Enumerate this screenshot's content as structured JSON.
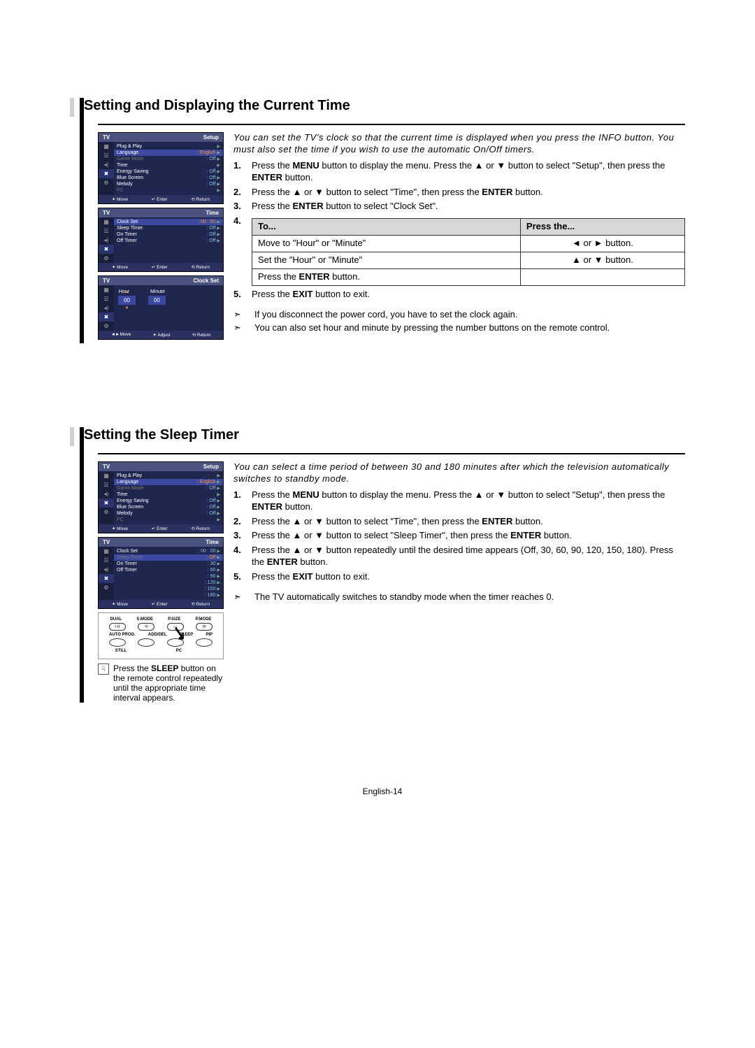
{
  "section1": {
    "title": "Setting and Displaying the Current Time",
    "intro": "You can set the TV's clock so that the current time is displayed when you press the INFO button. You must also set the time if you wish to use the automatic On/Off timers.",
    "steps": [
      {
        "n": "1.",
        "pre": "Press the ",
        "b1": "MENU",
        "mid": " button to display the menu. Press the ▲ or ▼ button to select \"Setup\", then press the ",
        "b2": "ENTER",
        "post": " button."
      },
      {
        "n": "2.",
        "pre": "Press the ▲ or ▼ button to select \"Time\", then press the ",
        "b1": "ENTER",
        "mid": "",
        "b2": "",
        "post": " button."
      },
      {
        "n": "3.",
        "pre": "Press the ",
        "b1": "ENTER",
        "mid": " button to select \"Clock Set\".",
        "b2": "",
        "post": ""
      }
    ],
    "step4n": "4.",
    "table": {
      "h1": "To...",
      "h2": "Press the...",
      "r1c1": "Move to \"Hour\" or \"Minute\"",
      "r1c2": "◄ or ► button.",
      "r2c1": "Set the \"Hour\" or \"Minute\"",
      "r2c2": "▲ or ▼ button.",
      "r3c1_pre": "Press the ",
      "r3c1_b": "ENTER",
      "r3c1_post": " button."
    },
    "step5": {
      "n": "5.",
      "pre": "Press the ",
      "b1": "EXIT",
      "post": " button to exit."
    },
    "notes": [
      "If you disconnect the power cord, you have to set the clock again.",
      "You can also set hour and minute by pressing the number buttons on the remote control."
    ]
  },
  "section2": {
    "title": "Setting the Sleep Timer",
    "intro": "You can select a time period of between 30 and 180 minutes after which the television automatically switches to standby mode.",
    "steps": [
      {
        "n": "1.",
        "pre": "Press the ",
        "b1": "MENU",
        "mid": " button to display the menu. Press the ▲ or ▼ button to select \"Setup\", then press the ",
        "b2": "ENTER",
        "post": " button."
      },
      {
        "n": "2.",
        "pre": "Press the ▲ or ▼ button to select \"Time\", then press the ",
        "b1": "ENTER",
        "mid": "",
        "b2": "",
        "post": " button."
      },
      {
        "n": "3.",
        "pre": "Press the ▲ or ▼ button to select \"Sleep Timer\", then press the ",
        "b1": "ENTER",
        "mid": "",
        "b2": "",
        "post": " button."
      },
      {
        "n": "4.",
        "pre": "Press the ▲ or ▼ button repeatedly until the desired time appears (Off, 30, 60, 90, 120, 150, 180). Press the ",
        "b1": "ENTER",
        "mid": "",
        "b2": "",
        "post": " button."
      },
      {
        "n": "5.",
        "pre": "Press the ",
        "b1": "EXIT",
        "mid": "",
        "b2": "",
        "post": " button to exit."
      }
    ],
    "note": "The TV automatically switches to standby mode when the timer reaches 0.",
    "tip_pre": "Press the ",
    "tip_b": "SLEEP",
    "tip_post": " button on the remote control repeatedly until the appropriate time interval appears."
  },
  "menus": {
    "tv": "TV",
    "setup": "Setup",
    "time": "Time",
    "clockset": "Clock Set",
    "setup_items": [
      {
        "l": "Plug & Play",
        "v": ""
      },
      {
        "l": "Language",
        "v": "English",
        "hl": true
      },
      {
        "l": "Game Mode",
        "v": "Off",
        "dim": true
      },
      {
        "l": "Time",
        "v": ""
      },
      {
        "l": "Energy Saving",
        "v": "Off"
      },
      {
        "l": "Blue Screen",
        "v": "Off"
      },
      {
        "l": "Melody",
        "v": "Off"
      },
      {
        "l": "PC",
        "v": "",
        "dim": true
      }
    ],
    "time_items1": [
      {
        "l": "Clock Set",
        "v": "00 : 00",
        "hl": true
      },
      {
        "l": "Sleep Timer",
        "v": "Off"
      },
      {
        "l": "On Timer",
        "v": "Off"
      },
      {
        "l": "Off Timer",
        "v": "Off"
      }
    ],
    "sleep_items": [
      {
        "l": "Clock Set",
        "v": "00 : 00"
      },
      {
        "l": "Sleep Timer",
        "v": "Off",
        "hl": true,
        "dim": true
      },
      {
        "l": "On Timer",
        "v": "30"
      },
      {
        "l": "Off Timer",
        "v": "60"
      },
      {
        "l": "",
        "v": "90"
      },
      {
        "l": "",
        "v": "120"
      },
      {
        "l": "",
        "v": "150"
      },
      {
        "l": "",
        "v": "180"
      }
    ],
    "hour": "Hour",
    "minute": "Minute",
    "hval": "00",
    "mval": "00",
    "f_move": "✦ Move",
    "f_move2": "◄►Move",
    "f_adjust": "✦ Adjust",
    "f_enter": "↵ Enter",
    "f_return": "⟲ Return"
  },
  "remote": {
    "row1": [
      "DUAL",
      "S.MODE",
      "P.SIZE",
      "P.MODE"
    ],
    "row2": [
      "AUTO PROG.",
      "ADD/DEL",
      "SLEEP",
      "PIP"
    ],
    "row3": [
      "STILL",
      "",
      "PC",
      ""
    ]
  },
  "footer": "English-14"
}
